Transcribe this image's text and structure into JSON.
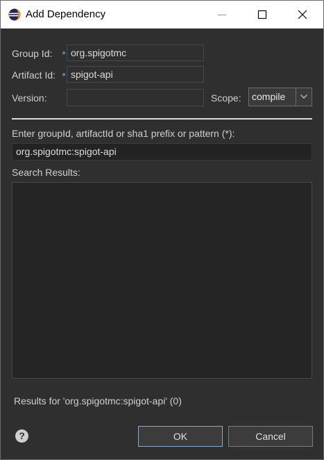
{
  "window": {
    "title": "Add Dependency"
  },
  "form": {
    "group_id": {
      "label": "Group Id:",
      "value": "org.spigotmc"
    },
    "artifact_id": {
      "label": "Artifact Id:",
      "value": "spigot-api"
    },
    "version": {
      "label": "Version:",
      "value": ""
    },
    "scope": {
      "label": "Scope:",
      "selected": "compile"
    }
  },
  "search": {
    "label": "Enter groupId, artifactId or sha1 prefix or pattern (*):",
    "value": "org.spigotmc:spigot-api",
    "results_label": "Search Results:"
  },
  "status": {
    "text": "Results for 'org.spigotmc:spigot-api' (0)"
  },
  "buttons": {
    "ok": "OK",
    "cancel": "Cancel"
  },
  "icons": {
    "app": "eclipse-icon",
    "help": "help-icon"
  }
}
